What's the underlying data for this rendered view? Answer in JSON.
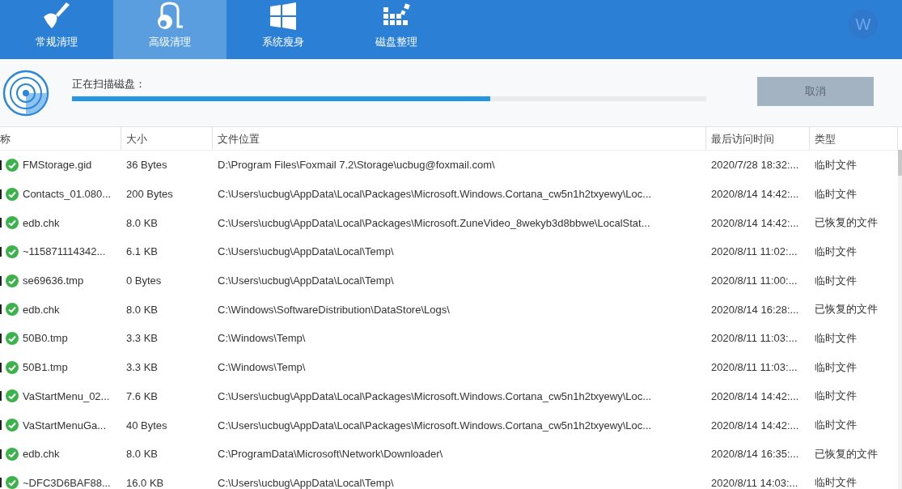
{
  "tabs": [
    {
      "label": "常规清理",
      "selected": false
    },
    {
      "label": "高级清理",
      "selected": true
    },
    {
      "label": "系统瘦身",
      "selected": false
    },
    {
      "label": "磁盘整理",
      "selected": false
    }
  ],
  "avatar": {
    "letter": "W"
  },
  "scan": {
    "label": "正在扫描磁盘：",
    "level": 0.66,
    "button": {
      "label": "取消",
      "disabled": true
    }
  },
  "table": {
    "columns": [
      "称",
      "大小",
      "文件位置",
      "最后访问时间",
      "类型"
    ],
    "rows": [
      {
        "checked": true,
        "cells": [
          "FMStorage.gid",
          "36 Bytes",
          "D:\\Program Files\\Foxmail 7.2\\Storage\\ucbug@foxmail.com\\",
          "2020/7/28 18:32:...",
          "临时文件"
        ]
      },
      {
        "checked": true,
        "cells": [
          "Contacts_01.080...",
          "200 Bytes",
          "C:\\Users\\ucbug\\AppData\\Local\\Packages\\Microsoft.Windows.Cortana_cw5n1h2txyewy\\Loc...",
          "2020/8/14 14:42:...",
          "临时文件"
        ]
      },
      {
        "checked": true,
        "cells": [
          "edb.chk",
          "8.0 KB",
          "C:\\Users\\ucbug\\AppData\\Local\\Packages\\Microsoft.ZuneVideo_8wekyb3d8bbwe\\LocalStat...",
          "2020/8/14 14:42:...",
          "已恢复的文件"
        ]
      },
      {
        "checked": true,
        "cells": [
          "~115871114342...",
          "6.1 KB",
          "C:\\Users\\ucbug\\AppData\\Local\\Temp\\",
          "2020/8/11 11:02:...",
          "临时文件"
        ]
      },
      {
        "checked": true,
        "cells": [
          "se69636.tmp",
          "0 Bytes",
          "C:\\Users\\ucbug\\AppData\\Local\\Temp\\",
          "2020/8/11 11:00:...",
          "临时文件"
        ]
      },
      {
        "checked": true,
        "cells": [
          "edb.chk",
          "8.0 KB",
          "C:\\Windows\\SoftwareDistribution\\DataStore\\Logs\\",
          "2020/8/14 16:28:...",
          "已恢复的文件"
        ]
      },
      {
        "checked": true,
        "cells": [
          "50B0.tmp",
          "3.3 KB",
          "C:\\Windows\\Temp\\",
          "2020/8/11 11:03:...",
          "临时文件"
        ]
      },
      {
        "checked": true,
        "cells": [
          "50B1.tmp",
          "3.3 KB",
          "C:\\Windows\\Temp\\",
          "2020/8/11 11:03:...",
          "临时文件"
        ]
      },
      {
        "checked": true,
        "cells": [
          "VaStartMenu_02...",
          "7.6 KB",
          "C:\\Users\\ucbug\\AppData\\Local\\Packages\\Microsoft.Windows.Cortana_cw5n1h2txyewy\\Loc...",
          "2020/8/14 14:42:...",
          "临时文件"
        ]
      },
      {
        "checked": true,
        "cells": [
          "VaStartMenuGa...",
          "40 Bytes",
          "C:\\Users\\ucbug\\AppData\\Local\\Packages\\Microsoft.Windows.Cortana_cw5n1h2txyewy\\Loc...",
          "2020/8/14 14:42:...",
          "临时文件"
        ]
      },
      {
        "checked": true,
        "cells": [
          "edb.chk",
          "8.0 KB",
          "C:\\ProgramData\\Microsoft\\Network\\Downloader\\",
          "2020/8/14 16:35:...",
          "已恢复的文件"
        ]
      },
      {
        "checked": true,
        "cells": [
          "~DFC3D6BAF88...",
          "16.0 KB",
          "C:\\Users\\ucbug\\AppData\\Local\\Temp\\",
          "2020/8/11 14:03:...",
          "临时文件"
        ]
      }
    ]
  }
}
